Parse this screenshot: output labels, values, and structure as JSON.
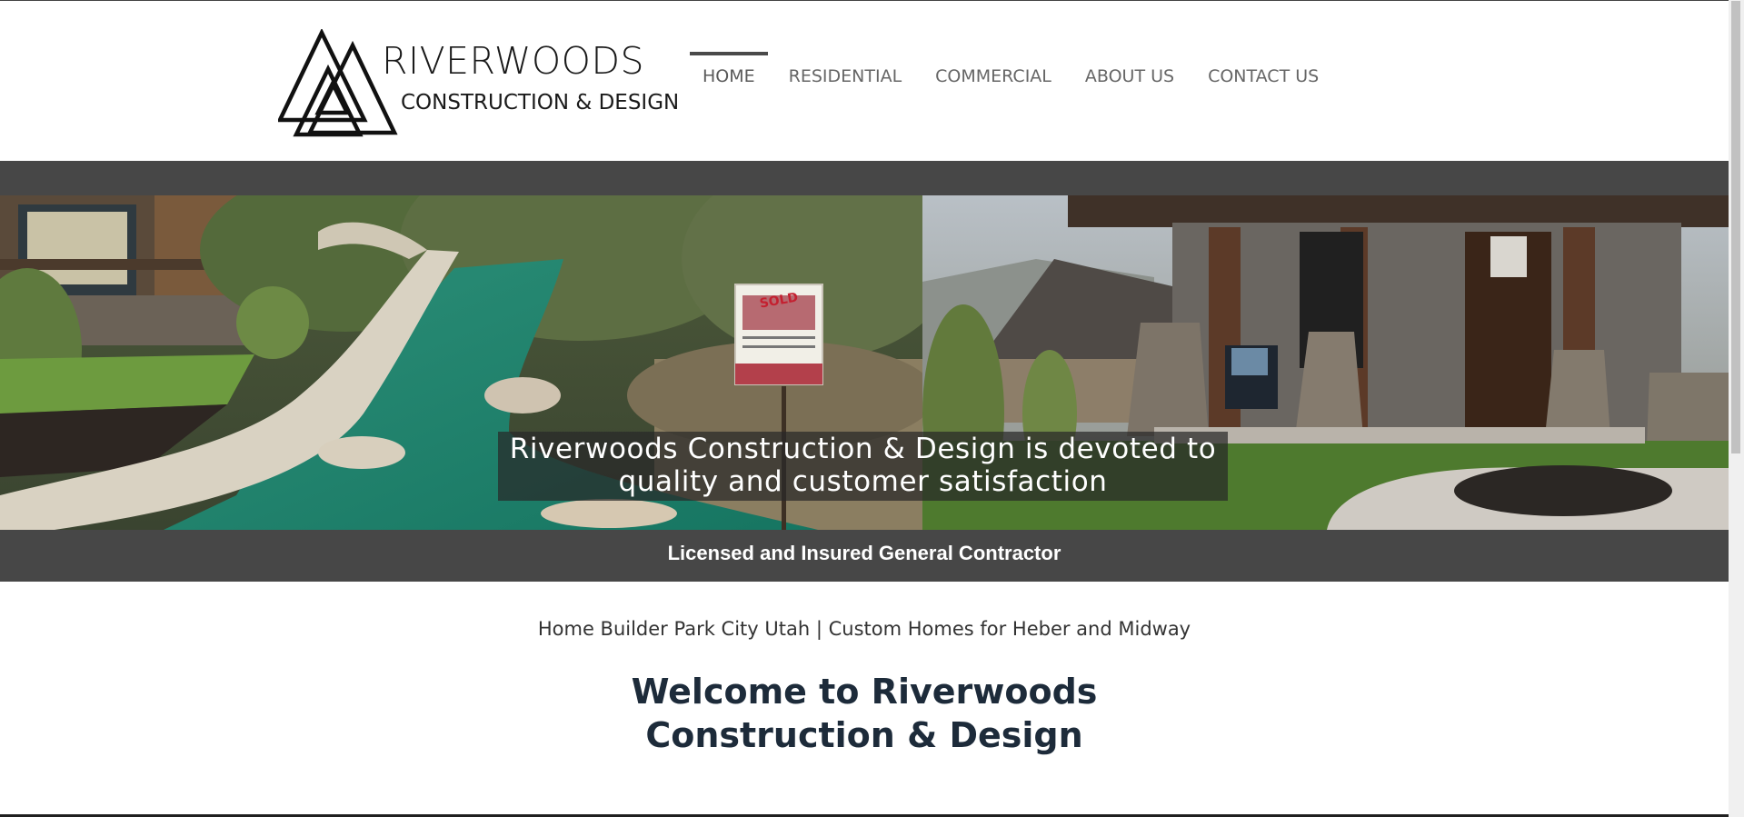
{
  "brand": {
    "title": "RIVERWOODS",
    "subtitle": "CONSTRUCTION & DESIGN",
    "logo_icon": "interlocked-triangles-logo"
  },
  "nav": {
    "items": [
      {
        "label": "HOME",
        "active": true
      },
      {
        "label": "RESIDENTIAL",
        "active": false
      },
      {
        "label": "COMMERCIAL",
        "active": false
      },
      {
        "label": "ABOUT US",
        "active": false
      },
      {
        "label": "CONTACT US",
        "active": false
      }
    ]
  },
  "hero": {
    "caption": "Riverwoods Construction & Design is devoted to quality and customer satisfaction",
    "sign_text": "SOLD",
    "banner_text": "Licensed and Insured General Contractor"
  },
  "content": {
    "tagline": "Home Builder Park City Utah | Custom Homes for Heber and Midway",
    "welcome": "Welcome to Riverwoods Construction & Design"
  },
  "colors": {
    "band": "#474747",
    "heading": "#1d2b3a",
    "nav_text": "#666666",
    "mulch": "#1f8a74"
  }
}
